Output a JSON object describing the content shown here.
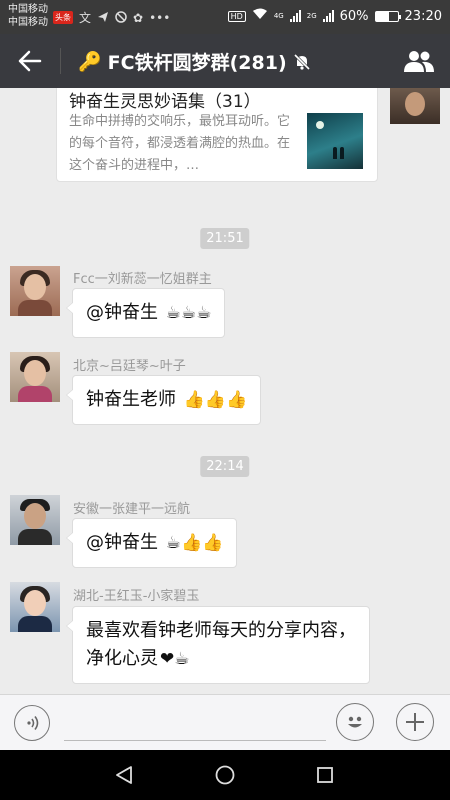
{
  "status_bar": {
    "carrier_1": "中国移动",
    "carrier_2": "中国移动",
    "app_badge": "头条",
    "network_1": "4G",
    "network_2": "2G",
    "battery": "60%",
    "battery_level": 0.6,
    "time": "23:20"
  },
  "header": {
    "title": "FC铁杆圆梦群(281)"
  },
  "messages": {
    "share": {
      "title": "钟奋生灵思妙语集（31）",
      "description": "生命中拼搏的交响乐，最悦耳动听。它的每个音符，都浸透着满腔的热血。在这个奋斗的进程中，…"
    },
    "time_1": "21:51",
    "time_2": "22:14",
    "items": [
      {
        "sender": "Fcc一刘新蕊一忆姐群主",
        "text": "@钟奋生",
        "emoji": "☕☕☕"
      },
      {
        "sender": "北京~吕廷琴~叶子",
        "text": "钟奋生老师",
        "emoji": "👍👍👍"
      },
      {
        "sender": "安徽一张建平一远航",
        "text": "@钟奋生",
        "emoji": "☕👍👍"
      },
      {
        "sender": "湖北-王红玉-小家碧玉",
        "line1": "最喜欢看钟老师每天的分享内容，",
        "line2": "净化心灵",
        "emoji": "❤☕"
      }
    ]
  },
  "input_bar": {
    "placeholder": ""
  },
  "colors": {
    "title_bar": "#393a3f",
    "status_bar": "#3a3a3a",
    "chat_bg": "#ececec"
  }
}
